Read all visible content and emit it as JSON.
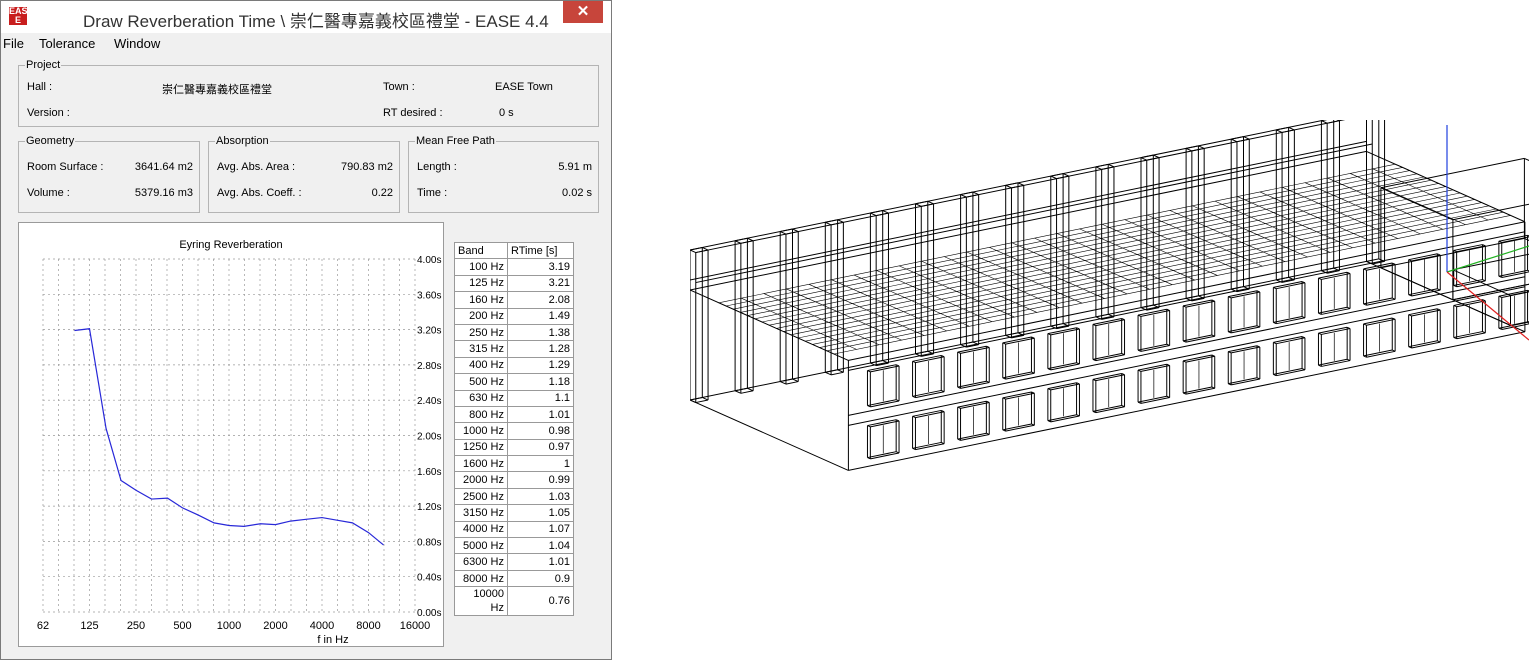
{
  "window": {
    "title": "Draw Reverberation Time \\ 崇仁醫專嘉義校區禮堂 - EASE 4.4",
    "icon": "ease-app-icon",
    "close_glyph": "✕"
  },
  "menu": [
    "File",
    "Tolerance",
    "Window"
  ],
  "project": {
    "legend": "Project",
    "hall_label": "Hall :",
    "hall_value": "崇仁醫專嘉義校區禮堂",
    "town_label": "Town :",
    "town_value": "EASE Town",
    "version_label": "Version :",
    "rt_desired_label": "RT desired :",
    "rt_desired_value": "0 s"
  },
  "geometry": {
    "legend": "Geometry",
    "surface_label": "Room Surface :",
    "surface_value": "3641.64 m2",
    "volume_label": "Volume :",
    "volume_value": "5379.16 m3"
  },
  "absorption": {
    "legend": "Absorption",
    "area_label": "Avg. Abs. Area :",
    "area_value": "790.83 m2",
    "coeff_label": "Avg. Abs. Coeff. :",
    "coeff_value": "0.22"
  },
  "mean_free_path": {
    "legend": "Mean Free Path",
    "length_label": "Length :",
    "length_value": "5.91 m",
    "time_label": "Time :",
    "time_value": "0.02 s"
  },
  "chart_data": {
    "type": "line",
    "title": "Eyring Reverberation",
    "xlabel": "f in Hz",
    "ylabel": "",
    "x_scale": "log",
    "x_ticks": [
      "62",
      "125",
      "250",
      "500",
      "1000",
      "2000",
      "4000",
      "8000",
      "16000"
    ],
    "y_ticks": [
      "0.00s",
      "0.40s",
      "0.80s",
      "1.20s",
      "1.60s",
      "2.00s",
      "2.40s",
      "2.80s",
      "3.20s",
      "3.60s",
      "4.00s"
    ],
    "ylim": [
      0,
      4.0
    ],
    "grid": true,
    "line_color": "#2828d8",
    "x": [
      100,
      125,
      160,
      200,
      250,
      315,
      400,
      500,
      630,
      800,
      1000,
      1250,
      1600,
      2000,
      2500,
      3150,
      4000,
      5000,
      6300,
      8000,
      10000
    ],
    "values": [
      3.19,
      3.21,
      2.08,
      1.49,
      1.38,
      1.28,
      1.29,
      1.18,
      1.1,
      1.01,
      0.98,
      0.97,
      1,
      0.99,
      1.03,
      1.05,
      1.07,
      1.04,
      1.01,
      0.9,
      0.76
    ]
  },
  "table": {
    "headers": [
      "Band",
      "RTime [s]"
    ],
    "rows": [
      [
        "100 Hz",
        "3.19"
      ],
      [
        "125 Hz",
        "3.21"
      ],
      [
        "160 Hz",
        "2.08"
      ],
      [
        "200 Hz",
        "1.49"
      ],
      [
        "250 Hz",
        "1.38"
      ],
      [
        "315 Hz",
        "1.28"
      ],
      [
        "400 Hz",
        "1.29"
      ],
      [
        "500 Hz",
        "1.18"
      ],
      [
        "630 Hz",
        "1.1"
      ],
      [
        "800 Hz",
        "1.01"
      ],
      [
        "1000 Hz",
        "0.98"
      ],
      [
        "1250 Hz",
        "0.97"
      ],
      [
        "1600 Hz",
        "1"
      ],
      [
        "2000 Hz",
        "0.99"
      ],
      [
        "2500 Hz",
        "1.03"
      ],
      [
        "3150 Hz",
        "1.05"
      ],
      [
        "4000 Hz",
        "1.07"
      ],
      [
        "5000 Hz",
        "1.04"
      ],
      [
        "6300 Hz",
        "1.01"
      ],
      [
        "8000 Hz",
        "0.9"
      ],
      [
        "10000 Hz",
        "0.76"
      ]
    ]
  },
  "model_view": {
    "axis_colors": {
      "x": "#e02020",
      "y": "#20b020",
      "z": "#2040e0"
    }
  }
}
